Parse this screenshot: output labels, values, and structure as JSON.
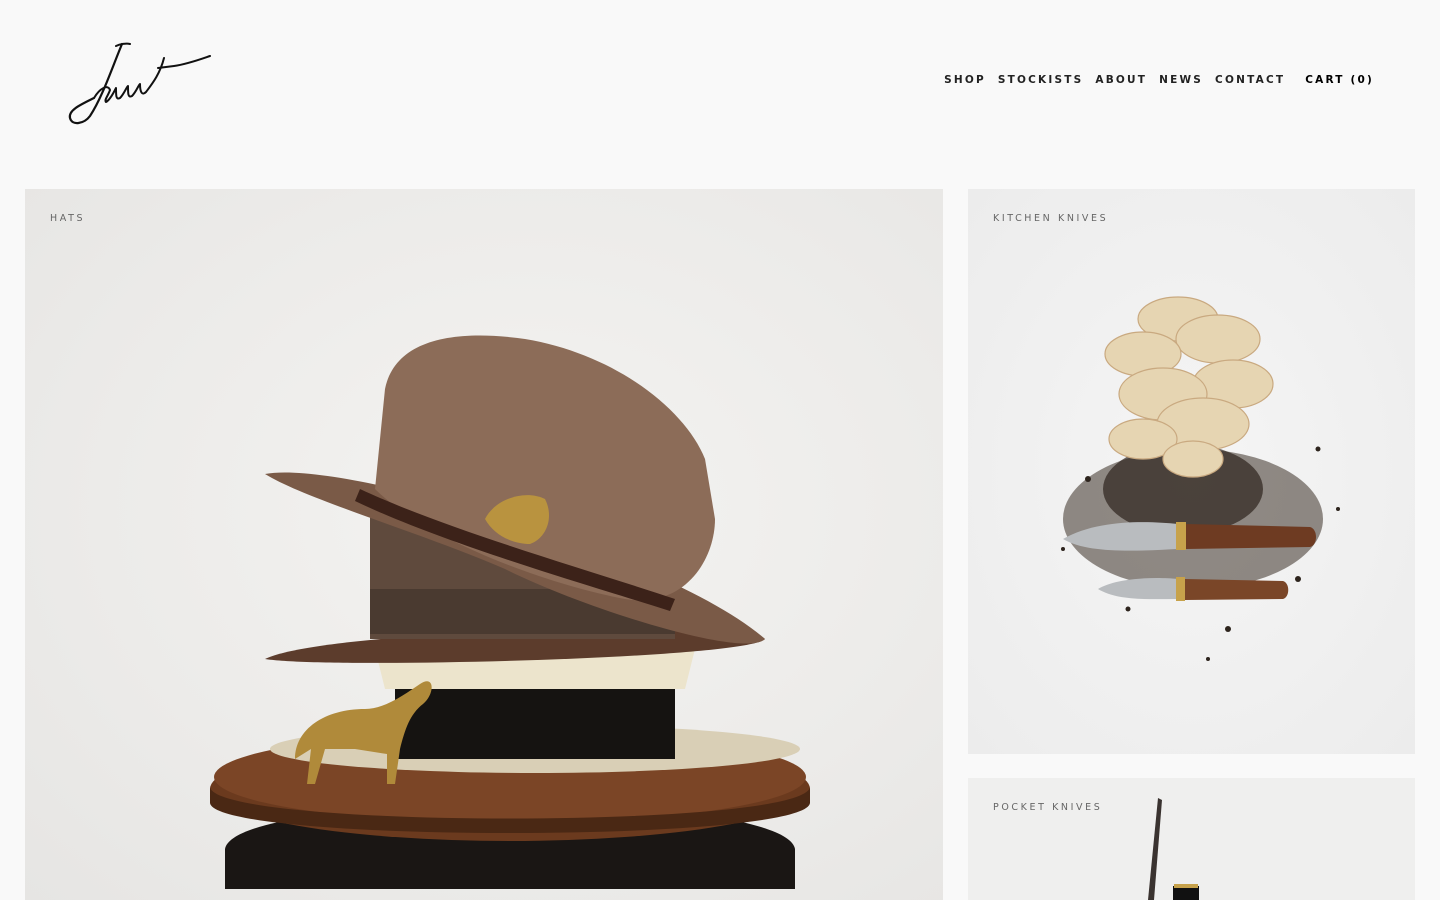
{
  "brand": {
    "logo_text": "Jaunt"
  },
  "nav": {
    "items": [
      {
        "label": "SHOP"
      },
      {
        "label": "STOCKISTS"
      },
      {
        "label": "ABOUT"
      },
      {
        "label": "NEWS"
      },
      {
        "label": "CONTACT"
      }
    ],
    "cart_label": "CART (0)"
  },
  "tiles": {
    "hats": {
      "label": "HATS"
    },
    "kitchen": {
      "label": "KITCHEN KNIVES"
    },
    "pocket": {
      "label": "POCKET KNIVES"
    }
  },
  "colors": {
    "background": "#f9f9f9",
    "text": "#111111",
    "label": "#666666"
  }
}
